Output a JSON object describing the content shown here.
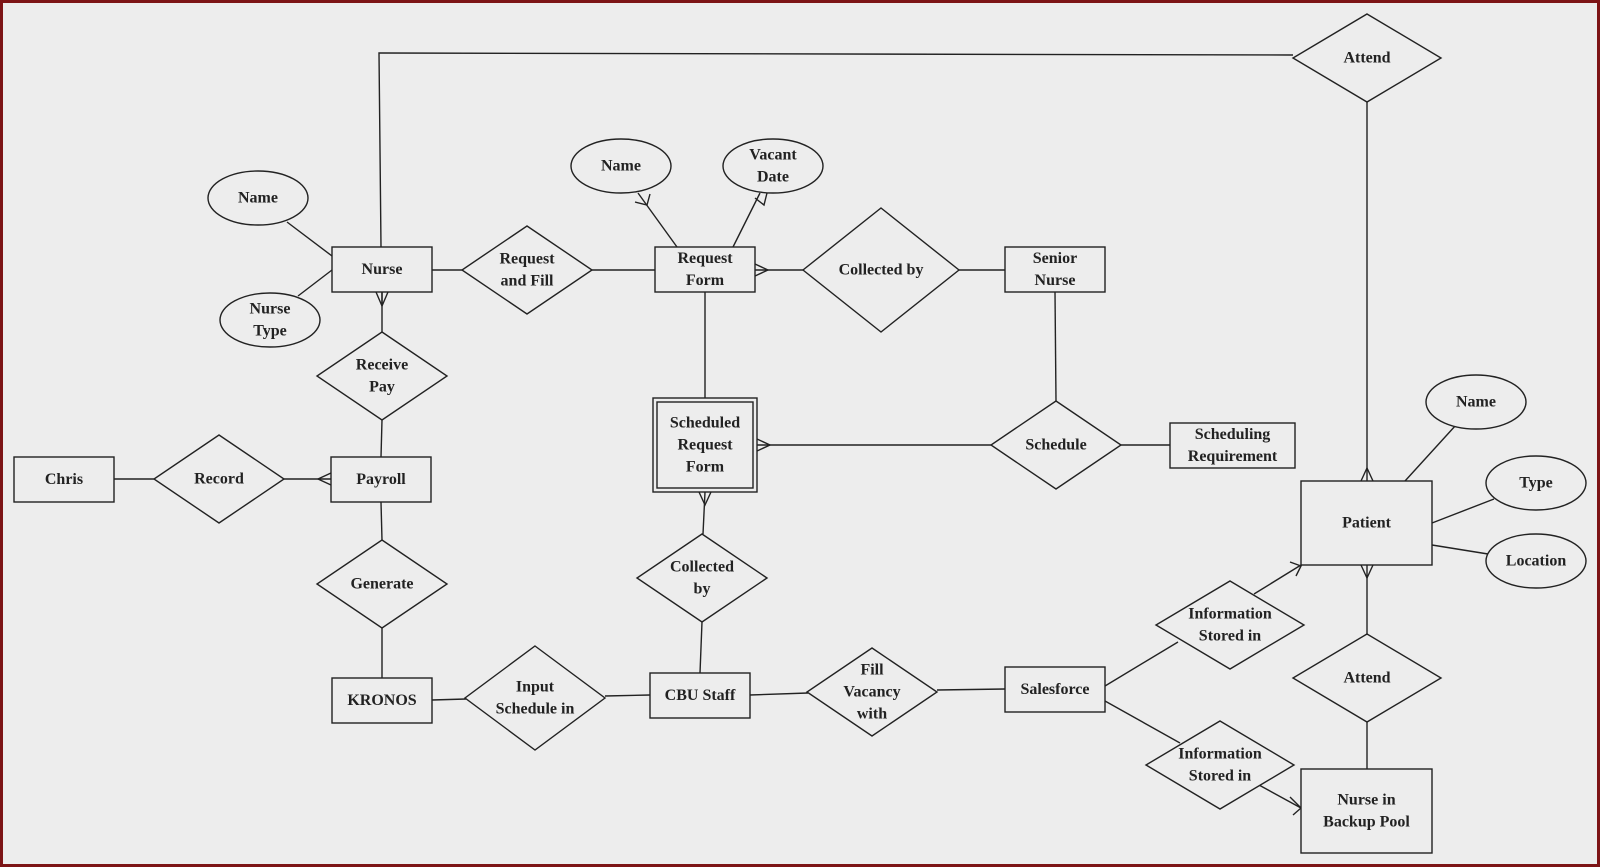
{
  "diagram": {
    "type": "entity-relationship",
    "colors": {
      "frame": "#7d1416",
      "background": "#ededed",
      "stroke": "#222222"
    },
    "entities": [
      {
        "id": "nurse",
        "label": [
          "Nurse"
        ]
      },
      {
        "id": "request_form",
        "label": [
          "Request",
          "Form"
        ]
      },
      {
        "id": "senior_nurse",
        "label": [
          "Senior",
          "Nurse"
        ]
      },
      {
        "id": "payroll",
        "label": [
          "Payroll"
        ]
      },
      {
        "id": "chris",
        "label": [
          "Chris"
        ]
      },
      {
        "id": "kronos",
        "label": [
          "KRONOS"
        ]
      },
      {
        "id": "cbu_staff",
        "label": [
          "CBU Staff"
        ]
      },
      {
        "id": "scheduled_request_form",
        "label": [
          "Scheduled",
          "Request",
          "Form"
        ],
        "weak": true
      },
      {
        "id": "scheduling_requirement",
        "label": [
          "Scheduling",
          "Requirement"
        ]
      },
      {
        "id": "salesforce",
        "label": [
          "Salesforce"
        ]
      },
      {
        "id": "patient",
        "label": [
          "Patient"
        ]
      },
      {
        "id": "nurse_backup_pool",
        "label": [
          "Nurse in",
          "Backup Pool"
        ]
      }
    ],
    "attributes": [
      {
        "id": "nurse_name",
        "label": [
          "Name"
        ],
        "of": "nurse"
      },
      {
        "id": "nurse_type",
        "label": [
          "Nurse",
          "Type"
        ],
        "of": "nurse"
      },
      {
        "id": "rf_name",
        "label": [
          "Name"
        ],
        "of": "request_form"
      },
      {
        "id": "rf_vacant_date",
        "label": [
          "Vacant",
          "Date"
        ],
        "of": "request_form"
      },
      {
        "id": "patient_name",
        "label": [
          "Name"
        ],
        "of": "patient"
      },
      {
        "id": "patient_type",
        "label": [
          "Type"
        ],
        "of": "patient"
      },
      {
        "id": "patient_location",
        "label": [
          "Location"
        ],
        "of": "patient"
      }
    ],
    "relationships": [
      {
        "id": "attend_top",
        "label": [
          "Attend"
        ],
        "between": [
          "nurse",
          "patient"
        ]
      },
      {
        "id": "request_and_fill",
        "label": [
          "Request",
          "and Fill"
        ],
        "between": [
          "nurse",
          "request_form"
        ]
      },
      {
        "id": "collected_by_top",
        "label": [
          "Collected by"
        ],
        "between": [
          "request_form",
          "senior_nurse"
        ]
      },
      {
        "id": "receive_pay",
        "label": [
          "Receive",
          "Pay"
        ],
        "between": [
          "nurse",
          "payroll"
        ]
      },
      {
        "id": "record",
        "label": [
          "Record"
        ],
        "between": [
          "chris",
          "payroll"
        ]
      },
      {
        "id": "generate",
        "label": [
          "Generate"
        ],
        "between": [
          "payroll",
          "kronos"
        ]
      },
      {
        "id": "schedule",
        "label": [
          "Schedule"
        ],
        "between": [
          "senior_nurse",
          "scheduled_request_form",
          "scheduling_requirement"
        ]
      },
      {
        "id": "collected_by_bottom",
        "label": [
          "Collected",
          "by"
        ],
        "between": [
          "scheduled_request_form",
          "cbu_staff"
        ]
      },
      {
        "id": "input_schedule_in",
        "label": [
          "Input",
          "Schedule in"
        ],
        "between": [
          "kronos",
          "cbu_staff"
        ]
      },
      {
        "id": "fill_vacancy_with",
        "label": [
          "Fill",
          "Vacancy",
          "with"
        ],
        "between": [
          "cbu_staff",
          "salesforce"
        ]
      },
      {
        "id": "info_stored_upper",
        "label": [
          "Information",
          "Stored in"
        ],
        "between": [
          "salesforce",
          "patient"
        ]
      },
      {
        "id": "info_stored_lower",
        "label": [
          "Information",
          "Stored in"
        ],
        "between": [
          "salesforce",
          "nurse_backup_pool"
        ]
      },
      {
        "id": "attend_bottom",
        "label": [
          "Attend"
        ],
        "between": [
          "patient",
          "nurse_backup_pool"
        ]
      }
    ]
  }
}
